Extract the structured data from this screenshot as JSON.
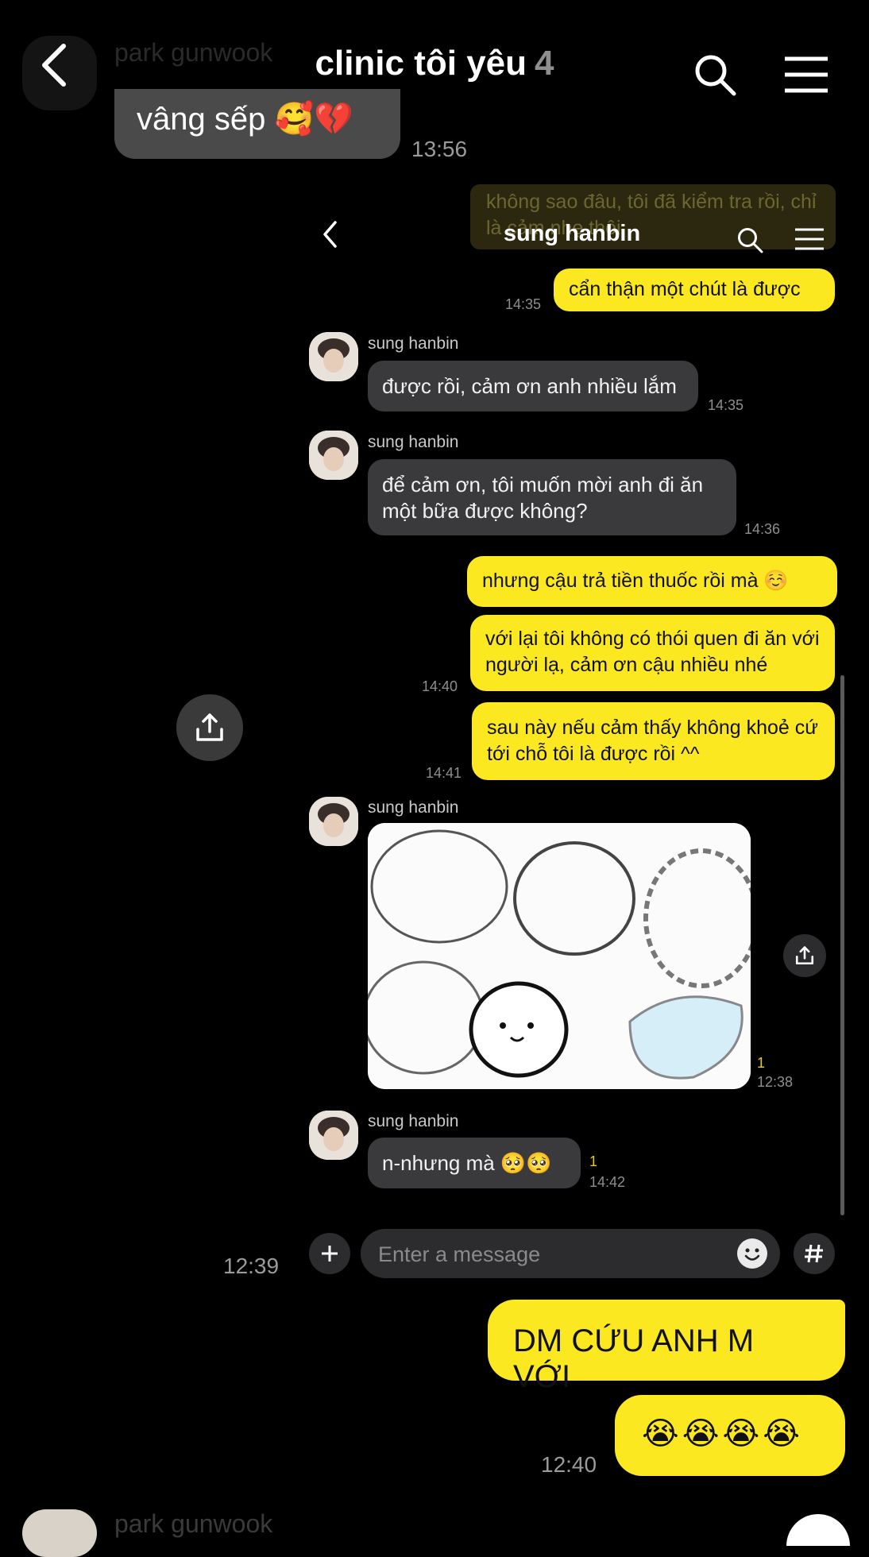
{
  "outer": {
    "title": "clinic tôi yêu",
    "member_count": "4",
    "ghost_sender_top": "park gunwook",
    "ghost_sender_bottom": "park gunwook",
    "grey_bubble_text": "vâng sếp 🥰💔",
    "grey_bubble_time": "13:56",
    "time_1": "12:39",
    "time_2": "12:40",
    "yellow_bubble_1": "DM CỨU ANH M VỚI",
    "yellow_bubble_2": "😭😭😭😭"
  },
  "inner": {
    "title": "sung hanbin",
    "ghost_message": "không sao đâu, tôi đã kiểm tra rồi, chỉ là cảm nhẹ thôi",
    "messages": [
      {
        "text": "cẩn thận một chút là được",
        "time": "14:35"
      },
      {
        "sender": "sung hanbin",
        "text": "được rồi, cảm ơn anh nhiều lắm",
        "time": "14:35"
      },
      {
        "sender": "sung hanbin",
        "text": "để cảm ơn, tôi muốn mời anh đi ăn một bữa được không?",
        "time": "14:36"
      },
      {
        "text": "nhưng cậu trả tiền thuốc rồi mà ☺️"
      },
      {
        "text": "với lại tôi không có thói quen đi ăn với người lạ, cảm ơn cậu nhiều nhé",
        "time": "14:40"
      },
      {
        "text": "sau này nếu cảm thấy không khoẻ cứ tới chỗ tôi là được rồi ^^",
        "time": "14:41"
      },
      {
        "sender": "sung hanbin",
        "unread": "1",
        "time": "12:38"
      },
      {
        "sender": "sung hanbin",
        "text": "n-nhưng mà 🥺🥺",
        "unread": "1",
        "time": "14:42"
      }
    ],
    "input_placeholder": "Enter a message"
  },
  "colors": {
    "accent_yellow": "#fce820",
    "bubble_grey": "#3a3a3c",
    "background": "#000000"
  },
  "icons": [
    "back-icon",
    "search-icon",
    "menu-icon",
    "share-icon",
    "plus-icon",
    "emoji-icon",
    "hash-icon"
  ]
}
